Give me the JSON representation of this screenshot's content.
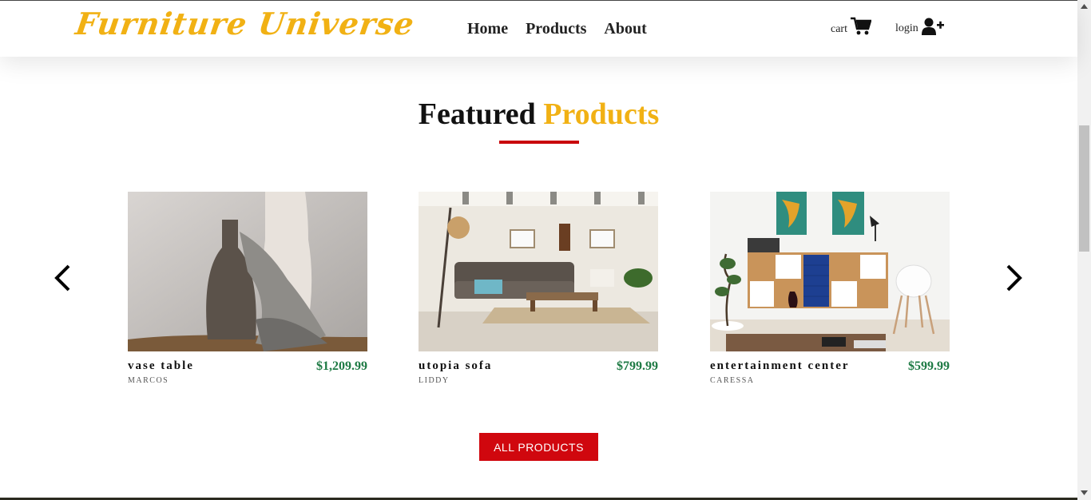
{
  "header": {
    "logo": "Furniture Universe",
    "nav": [
      "Home",
      "Products",
      "About"
    ],
    "cart_label": "cart",
    "login_label": "login"
  },
  "section": {
    "title_main": "Featured",
    "title_accent": "Products"
  },
  "products": [
    {
      "name": "vase table",
      "price": "$1,209.99",
      "maker": "MARCOS"
    },
    {
      "name": "utopia sofa",
      "price": "$799.99",
      "maker": "LIDDY"
    },
    {
      "name": "entertainment center",
      "price": "$599.99",
      "maker": "CARESSA"
    }
  ],
  "all_products_label": "ALL PRODUCTS",
  "colors": {
    "brand_yellow": "#f1b114",
    "accent_red": "#d0070e",
    "price_green": "#1e7a44"
  },
  "icons": {
    "cart": "cart-icon",
    "login": "user-plus-icon",
    "prev": "chevron-left-icon",
    "next": "chevron-right-icon"
  }
}
